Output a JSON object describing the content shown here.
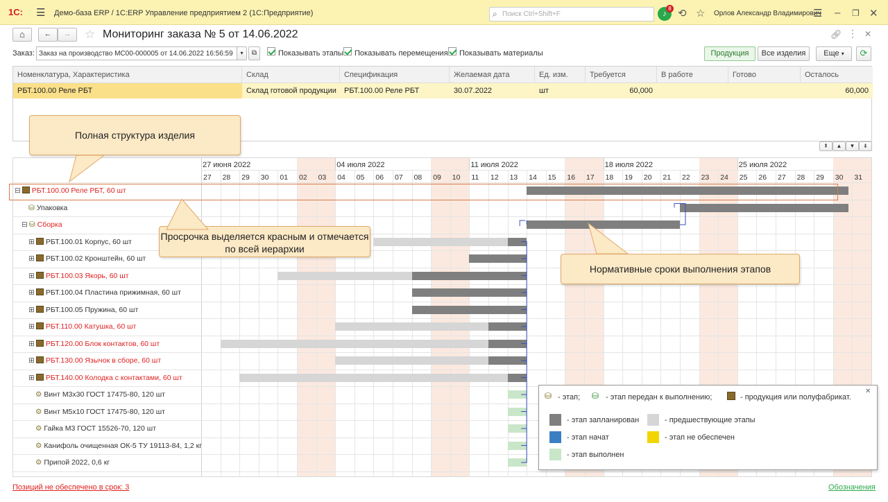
{
  "titlebar": {
    "logo": "1С:",
    "app_title": "Демо-база ERP / 1С:ERP Управление предприятием 2  (1С:Предприятие)",
    "search_placeholder": "Поиск Ctrl+Shift+F",
    "notifications_count": "8",
    "user": "Орлов Александр Владимирович"
  },
  "page": {
    "title": "Мониторинг заказа № 5 от 14.06.2022"
  },
  "order": {
    "label": "Заказ:",
    "value": "Заказ на производство МС00-000005 от 14.06.2022 16:56:59",
    "checkboxes": [
      {
        "label": "Показывать этапы",
        "checked": true
      },
      {
        "label": "Показывать перемещения",
        "checked": true
      },
      {
        "label": "Показывать материалы",
        "checked": true
      }
    ],
    "buttons": {
      "products": "Продукция",
      "all_items": "Все изделия",
      "more": "Еще"
    }
  },
  "table": {
    "columns": [
      "Номенклатура, Характеристика",
      "Склад",
      "Спецификация",
      "Желаемая дата",
      "Ед. изм.",
      "Требуется",
      "В работе",
      "Готово",
      "Осталось"
    ],
    "rows": [
      [
        "РБТ.100.00 Реле РБТ",
        "Склад готовой продукции",
        "РБТ.100.00 Реле РБТ",
        "30.07.2022",
        "шт",
        "60,000",
        "",
        "",
        "60,000"
      ]
    ]
  },
  "gantt": {
    "weeks": [
      "27 июня 2022",
      "04 июля 2022",
      "11 июля 2022",
      "18 июля 2022",
      "25 июля 2022"
    ],
    "days": [
      "27",
      "28",
      "29",
      "30",
      "01",
      "02",
      "03",
      "04",
      "05",
      "06",
      "07",
      "08",
      "09",
      "10",
      "11",
      "12",
      "13",
      "14",
      "15",
      "16",
      "17",
      "18",
      "19",
      "20",
      "21",
      "22",
      "23",
      "24",
      "25",
      "26",
      "27",
      "28",
      "29",
      "30",
      "31"
    ],
    "weekend_day_indices": [
      5,
      6,
      12,
      13,
      19,
      20,
      26,
      27,
      33,
      34
    ],
    "rows": [
      {
        "label": "РБТ.100.00 Реле РБТ, 60 шт",
        "red": true,
        "indent": 0,
        "expander": "⊟",
        "icon": "product",
        "bars": [
          {
            "type": "planned",
            "start": 17.0,
            "end": 33.8
          }
        ]
      },
      {
        "label": "Упаковка",
        "red": false,
        "indent": 1,
        "expander": "",
        "icon": "stage",
        "bars": [
          {
            "type": "planned",
            "start": 25.0,
            "end": 33.8
          }
        ]
      },
      {
        "label": "Сборка",
        "red": true,
        "indent": 1,
        "expander": "⊟",
        "icon": "stage",
        "bars": [
          {
            "type": "planned",
            "start": 17.0,
            "end": 25.0
          }
        ]
      },
      {
        "label": "РБТ.100.01 Корпус, 60 шт",
        "red": false,
        "indent": 2,
        "expander": "⊞",
        "icon": "product",
        "bars": [
          {
            "type": "prev",
            "start": 9.0,
            "end": 16.0
          },
          {
            "type": "planned",
            "start": 16.0,
            "end": 17.0
          }
        ]
      },
      {
        "label": "РБТ.100.02 Кронштейн, 60 шт",
        "red": false,
        "indent": 2,
        "expander": "⊞",
        "icon": "product",
        "bars": [
          {
            "type": "planned",
            "start": 14.0,
            "end": 17.0
          }
        ]
      },
      {
        "label": "РБТ.100.03 Якорь, 60 шт",
        "red": true,
        "indent": 2,
        "expander": "⊞",
        "icon": "product",
        "bars": [
          {
            "type": "prev",
            "start": 4.0,
            "end": 11.0
          },
          {
            "type": "planned",
            "start": 11.0,
            "end": 17.0
          }
        ]
      },
      {
        "label": "РБТ.100.04 Пластина прижимная, 60 шт",
        "red": false,
        "indent": 2,
        "expander": "⊞",
        "icon": "product",
        "bars": [
          {
            "type": "planned",
            "start": 11.0,
            "end": 17.0
          }
        ]
      },
      {
        "label": "РБТ.100.05 Пружина, 60 шт",
        "red": false,
        "indent": 2,
        "expander": "⊞",
        "icon": "product",
        "bars": [
          {
            "type": "planned",
            "start": 11.0,
            "end": 17.0
          }
        ]
      },
      {
        "label": "РБТ.110.00 Катушка, 60 шт",
        "red": true,
        "indent": 2,
        "expander": "⊞",
        "icon": "product",
        "bars": [
          {
            "type": "prev",
            "start": 7.0,
            "end": 15.0
          },
          {
            "type": "planned",
            "start": 15.0,
            "end": 17.0
          }
        ]
      },
      {
        "label": "РБТ.120.00 Блок контактов, 60 шт",
        "red": true,
        "indent": 2,
        "expander": "⊞",
        "icon": "product",
        "bars": [
          {
            "type": "prev",
            "start": 1.0,
            "end": 15.0
          },
          {
            "type": "planned",
            "start": 15.0,
            "end": 17.0
          }
        ]
      },
      {
        "label": "РБТ.130.00 Язычок в сборе, 60 шт",
        "red": true,
        "indent": 2,
        "expander": "⊞",
        "icon": "product",
        "bars": [
          {
            "type": "prev",
            "start": 7.0,
            "end": 15.0
          },
          {
            "type": "planned",
            "start": 15.0,
            "end": 17.0
          }
        ]
      },
      {
        "label": "РБТ.140.00 Колодка с контактами, 60 шт",
        "red": true,
        "indent": 2,
        "expander": "⊞",
        "icon": "product",
        "bars": [
          {
            "type": "prev",
            "start": 2.0,
            "end": 16.0
          },
          {
            "type": "planned",
            "start": 16.0,
            "end": 17.0
          }
        ]
      },
      {
        "label": "Винт М3х30 ГОСТ 17475-80, 120 шт",
        "red": false,
        "indent": 2,
        "expander": "",
        "icon": "material",
        "bars": [
          {
            "type": "done",
            "start": 16.0,
            "end": 17.0
          }
        ]
      },
      {
        "label": "Винт М5х10 ГОСТ 17475-80, 120 шт",
        "red": false,
        "indent": 2,
        "expander": "",
        "icon": "material",
        "bars": [
          {
            "type": "done",
            "start": 16.0,
            "end": 17.0
          }
        ]
      },
      {
        "label": "Гайка М3 ГОСТ 15526-70, 120 шт",
        "red": false,
        "indent": 2,
        "expander": "",
        "icon": "material",
        "bars": [
          {
            "type": "done",
            "start": 16.0,
            "end": 17.0
          }
        ]
      },
      {
        "label": "Канифоль очищенная ОК-5 ТУ 19113-84, 1,2 кг",
        "red": false,
        "indent": 2,
        "expander": "",
        "icon": "material",
        "bars": [
          {
            "type": "done",
            "start": 16.0,
            "end": 17.0
          }
        ]
      },
      {
        "label": "Припой 2022, 0,6 кг",
        "red": false,
        "indent": 2,
        "expander": "",
        "icon": "material",
        "bars": [
          {
            "type": "done",
            "start": 16.0,
            "end": 17.0
          }
        ]
      }
    ]
  },
  "callouts": {
    "structure": "Полная структура изделия",
    "overdue": "Просрочка выделяется красным и отмечается по всей иерархии",
    "norms": "Нормативные сроки выполнения этапов"
  },
  "legend": {
    "stage": "- этап;",
    "stage_sent": "- этап передан к выполнению;",
    "product": "- продукция или полуфабрикат.",
    "planned": "- этап запланирован",
    "previous": "- предшествующие этапы",
    "started": "- этап начат",
    "not_provided": "- этап не обеспечен",
    "done": "- этап выполнен",
    "colors": {
      "planned": "#7f7f7f",
      "previous": "#d6d6d6",
      "started": "#3a7fc1",
      "not_provided": "#f2d500",
      "done": "#c9e6c9"
    }
  },
  "footer": {
    "left": "Позиций не обеспечено в срок: 3",
    "right": "Обозначения"
  }
}
